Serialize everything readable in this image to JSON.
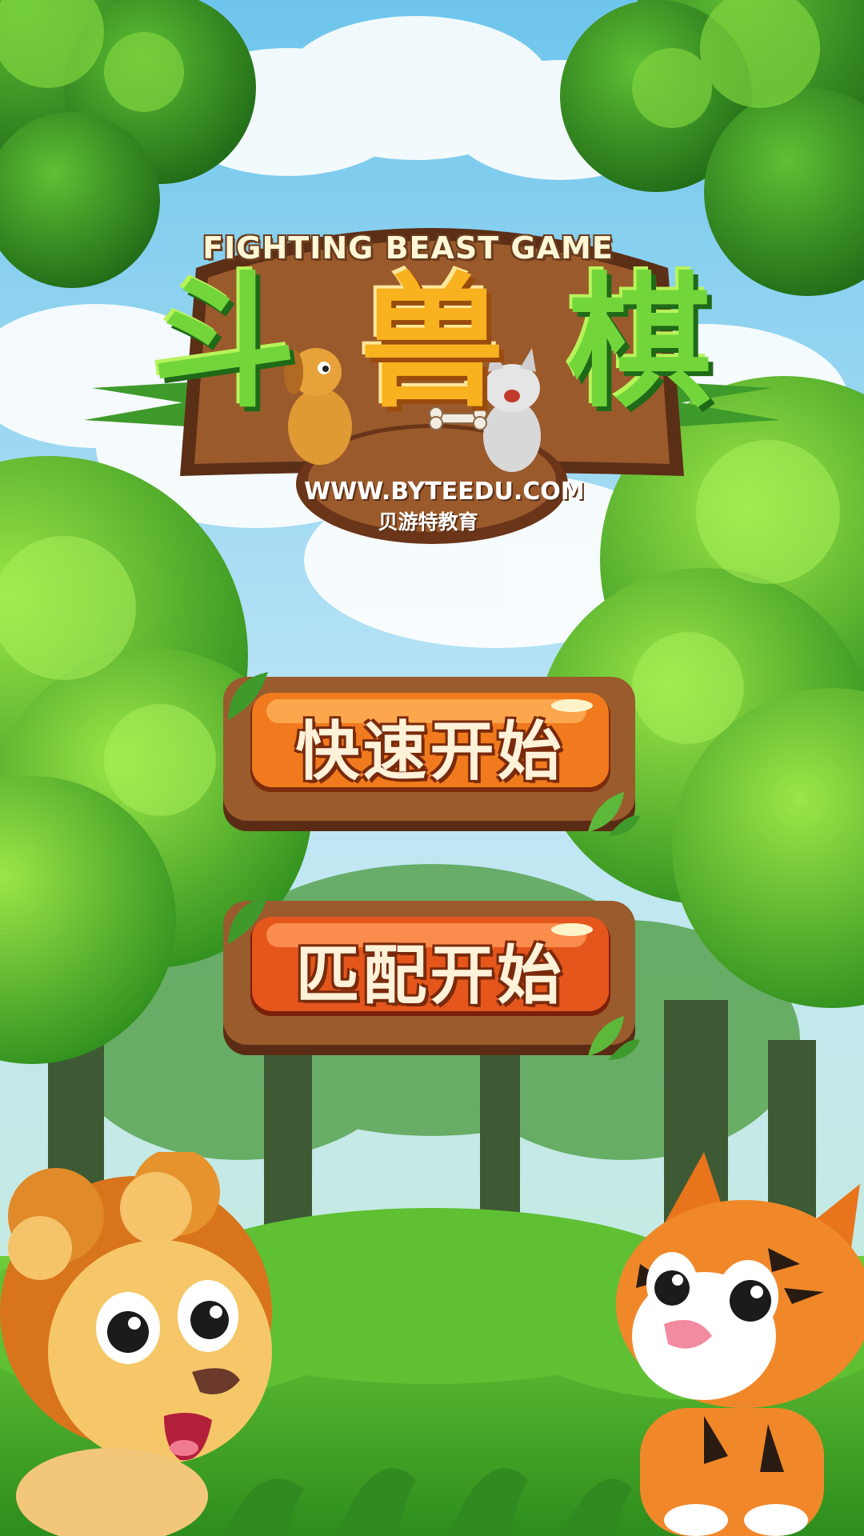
{
  "logo": {
    "subtitle": "FIGHTING BEAST GAME",
    "title_chars": [
      "斗",
      "兽",
      "棋"
    ],
    "url": "WWW.BYTEEDU.COM",
    "brand": "贝游特教育"
  },
  "menu": {
    "quick_start_label": "快速开始",
    "match_start_label": "匹配开始"
  },
  "characters": {
    "left": "lion",
    "right": "tiger",
    "logo_animals": [
      "dog",
      "cat"
    ]
  },
  "colors": {
    "sky": "#9fd6ef",
    "foliage": "#4fb82f",
    "button_orange": "#f07a1d",
    "wood": "#8a4f27"
  }
}
